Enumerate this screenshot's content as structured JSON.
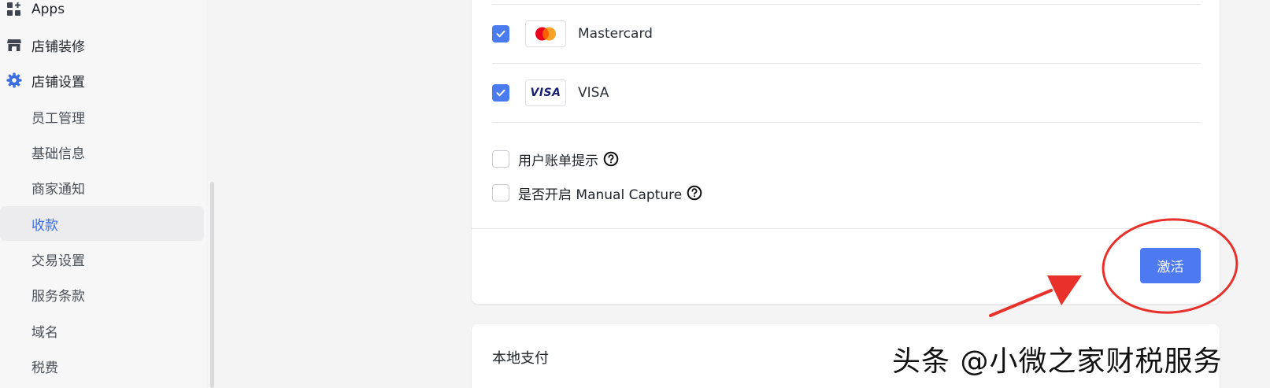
{
  "sidebar": {
    "items": [
      {
        "label": "Apps",
        "icon": "apps-icon"
      },
      {
        "label": "店铺装修",
        "icon": "store-icon"
      },
      {
        "label": "店铺设置",
        "icon": "gear-icon"
      },
      {
        "label": "员工管理"
      },
      {
        "label": "基础信息"
      },
      {
        "label": "商家通知"
      },
      {
        "label": "收款",
        "active": true
      },
      {
        "label": "交易设置"
      },
      {
        "label": "服务条款"
      },
      {
        "label": "域名"
      },
      {
        "label": "税费"
      }
    ]
  },
  "payment": {
    "methods": [
      {
        "label": "Mastercard",
        "checked": true,
        "icon": "mastercard-logo"
      },
      {
        "label": "VISA",
        "checked": true,
        "icon": "visa-logo",
        "logo_text": "VISA"
      }
    ],
    "options": [
      {
        "label": "用户账单提示",
        "checked": false
      },
      {
        "label": "是否开启 Manual Capture",
        "checked": false
      }
    ],
    "activate_label": "激活"
  },
  "local_payment": {
    "title": "本地支付"
  },
  "watermark": "头条 @小微之家财税服务",
  "colors": {
    "accent": "#4d7af0",
    "active_nav": "#3b6ce0",
    "annotation_red": "#e8312a"
  }
}
